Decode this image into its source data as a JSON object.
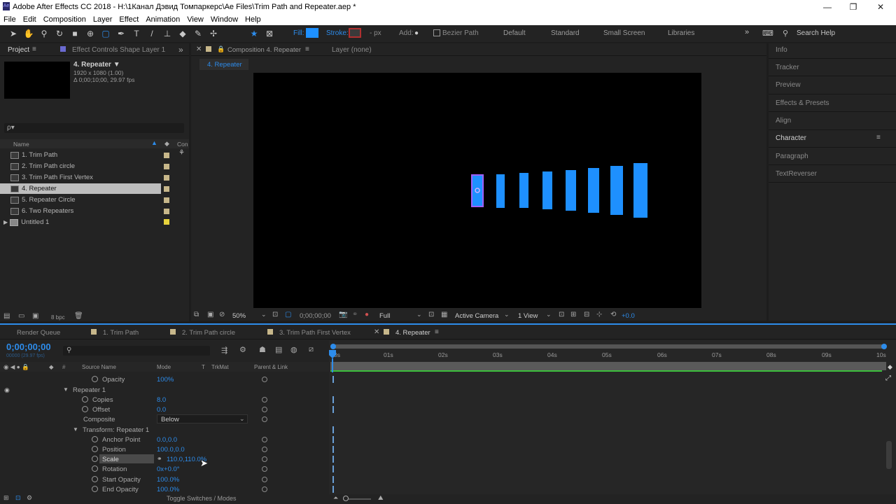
{
  "app": {
    "title": "Adobe After Effects CC 2018 - H:\\1Канал Дэвид Томпаркерс\\Ae Files\\Trim Path and Repeater.aep *",
    "window_controls": [
      "—",
      "❐",
      "✕"
    ]
  },
  "menu": [
    "File",
    "Edit",
    "Composition",
    "Layer",
    "Effect",
    "Animation",
    "View",
    "Window",
    "Help"
  ],
  "toolbar": {
    "fill_label": "Fill:",
    "stroke_label": "Stroke:",
    "stroke_unit": "- px",
    "add_label": "Add:",
    "bezier_label": "Bezier Path",
    "workspaces": [
      "Default",
      "Standard",
      "Small Screen",
      "Libraries"
    ],
    "search_help": "Search Help",
    "fill_color": "#1e90ff",
    "stroke_color": "#b03030"
  },
  "project": {
    "tab": "Project",
    "tab2": "Effect Controls Shape Layer 1",
    "comp_name": "4. Repeater ▼",
    "comp_size": "1920 x 1080 (1.00)",
    "comp_duration": "Δ 0;00;10;00, 29.97 fps",
    "search_placeholder": "ρ▾",
    "col_name": "Name",
    "col_comment": "Con",
    "items": [
      {
        "name": "1. Trim Path",
        "selected": false
      },
      {
        "name": "2. Trim Path circle",
        "selected": false
      },
      {
        "name": "3. Trim Path First Vertex",
        "selected": false
      },
      {
        "name": "4. Repeater",
        "selected": true
      },
      {
        "name": "5. Repeater Circle",
        "selected": false
      },
      {
        "name": "6. Two Repeaters",
        "selected": false
      },
      {
        "name": "Untitled 1",
        "selected": false
      }
    ],
    "bpc": "8 bpc"
  },
  "composition": {
    "tab": "Composition 4. Repeater",
    "layer_tab": "Layer (none)",
    "breadcrumb": "4. Repeater",
    "zoom": "50%",
    "timecode": "0;00;00;00",
    "resolution": "Full",
    "camera": "Active Camera",
    "views": "1 View",
    "exposure": "+0.0",
    "bar_color": "#1e90ff"
  },
  "right_panel": {
    "items": [
      "Info",
      "Tracker",
      "Preview",
      "Effects & Presets",
      "Align",
      "Character",
      "Paragraph",
      "TextReverser"
    ]
  },
  "timeline": {
    "tabs": [
      "Render Queue",
      "1. Trim Path",
      "2. Trim Path circle",
      "3. Trim Path First Vertex",
      "4. Repeater"
    ],
    "timecode": "0;00;00;00",
    "sub_timecode": "00000 (29.97 fps)",
    "col_source": "Source Name",
    "col_mode": "Mode",
    "col_t": "T",
    "col_trkmat": "TrkMat",
    "col_parent": "Parent & Link",
    "ruler": [
      "0s",
      "01s",
      "02s",
      "03s",
      "04s",
      "05s",
      "06s",
      "07s",
      "08s",
      "09s",
      "10s"
    ],
    "rows": [
      {
        "label": "Opacity",
        "value": "100%"
      },
      {
        "label": "Repeater 1",
        "value": ""
      },
      {
        "label": "Copies",
        "value": "8.0"
      },
      {
        "label": "Offset",
        "value": "0.0"
      },
      {
        "label": "Composite",
        "value": "Below"
      },
      {
        "label": "Transform: Repeater 1",
        "value": ""
      },
      {
        "label": "Anchor Point",
        "value": "0.0,0.0"
      },
      {
        "label": "Position",
        "value": "100.0,0.0"
      },
      {
        "label": "Scale",
        "value": "110.0,110.0%"
      },
      {
        "label": "Rotation",
        "value": "0x+0.0°"
      },
      {
        "label": "Start Opacity",
        "value": "100.0%"
      },
      {
        "label": "End Opacity",
        "value": "100.0%"
      }
    ],
    "toggle_label": "Toggle Switches / Modes"
  }
}
